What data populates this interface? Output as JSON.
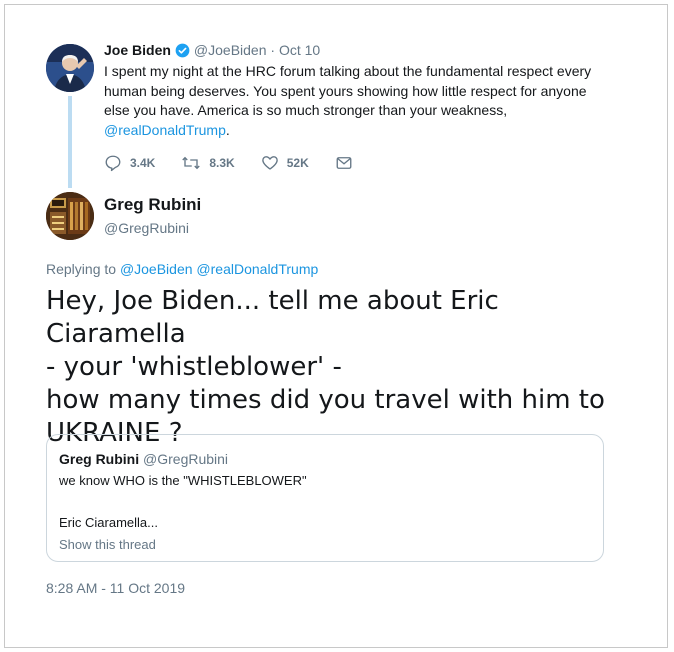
{
  "parent_tweet": {
    "name": "Joe Biden",
    "handle": "@JoeBiden",
    "separator": "·",
    "date": "Oct 10",
    "text_lines": [
      "I spent my night at the HRC forum talking about the fundamental respect every",
      "human being deserves. You spent yours showing how little respect for anyone",
      "else you have. America is so much stronger than your weakness,"
    ],
    "mention": "@realDonaldTrump",
    "mention_suffix": ".",
    "replies": "3.4K",
    "retweets": "8.3K",
    "likes": "52K",
    "icons": [
      "reply-icon",
      "retweet-icon",
      "like-icon",
      "message-icon",
      "verified-badge-icon"
    ]
  },
  "main_tweet": {
    "name": "Greg Rubini",
    "handle": "@GregRubini",
    "replying_prefix": "Replying to",
    "replying_to": [
      "@JoeBiden",
      "@realDonaldTrump"
    ],
    "text_lines": [
      "Hey, Joe Biden... tell me about Eric Ciaramella",
      "- your 'whistleblower' -",
      "how many times did you travel with him to",
      "UKRAINE ?"
    ],
    "timestamp": "8:28 AM - 11 Oct 2019"
  },
  "quoted_tweet": {
    "name": "Greg Rubini",
    "handle": "@GregRubini",
    "line1": "we know WHO is the \"WHISTLEBLOWER\"",
    "line2": "Eric Ciaramella...",
    "show_thread": "Show this thread"
  },
  "colors": {
    "link": "#1b95e0",
    "muted": "#657786",
    "thread_line": "#bcdcf2",
    "verified": "#1da1f2"
  }
}
